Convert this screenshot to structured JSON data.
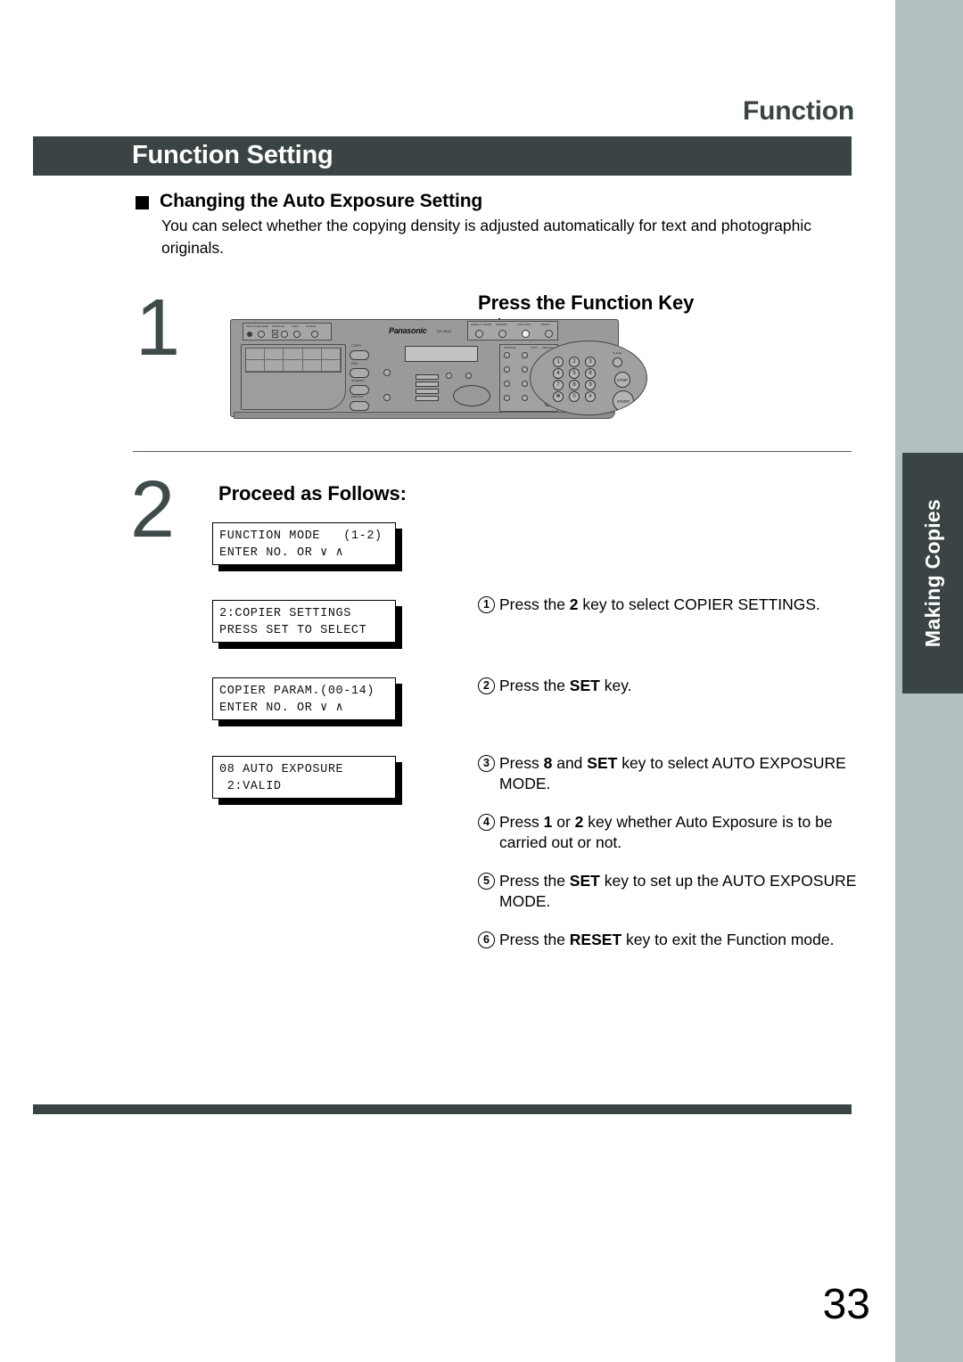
{
  "page": {
    "running_head": "Function",
    "number": "33"
  },
  "section": {
    "title": "Function Setting"
  },
  "subsection": {
    "heading": "Changing the Auto Exposure Setting",
    "intro": "You can select whether the copying density is adjusted automatically for text and photographic originals."
  },
  "side_tab": {
    "label": "Making Copies"
  },
  "steps": [
    {
      "number": "1",
      "heading": "Press the Function Key"
    },
    {
      "number": "2",
      "heading": "Proceed as Follows:"
    }
  ],
  "lcd_displays": [
    {
      "line1": "FUNCTION MODE   (1-2)",
      "line2": "ENTER NO. OR ∨ ∧"
    },
    {
      "line1": "2:COPIER SETTINGS",
      "line2": "PRESS SET TO SELECT"
    },
    {
      "line1": "COPIER PARAM.(00-14)",
      "line2": "ENTER NO. OR ∨ ∧"
    },
    {
      "line1": "08 AUTO EXPOSURE",
      "line2": " 2:VALID"
    }
  ],
  "instructions": [
    {
      "marker": "1",
      "pre": "Press the ",
      "bold": "2",
      "post": " key to select COPIER SETTINGS."
    },
    {
      "marker": "2",
      "pre": "Press the ",
      "bold": "SET",
      "post": " key."
    },
    {
      "marker": "3",
      "pre": "Press ",
      "bold": "8",
      "post": " and ",
      "bold2": "SET",
      "post2": " key to select AUTO EXPOSURE MODE."
    },
    {
      "marker": "4",
      "pre": "Press ",
      "bold": "1",
      "post": " or ",
      "bold2": "2",
      "post2": " key whether Auto Exposure is to be carried out or not."
    },
    {
      "marker": "5",
      "pre": "Press the ",
      "bold": "SET",
      "post": " key to set up the AUTO EXPOSURE MODE."
    },
    {
      "marker": "6",
      "pre": "Press the ",
      "bold": "RESET",
      "post": " key to exit the Function mode."
    }
  ],
  "control_panel": {
    "brand": "Panasonic",
    "model": "DP-2000",
    "top_right_keys": [
      "ENERGY SAVER",
      "MEMORY",
      "FUNCTION",
      "RESET"
    ],
    "mode_keys": [
      "COPY",
      "FAX",
      "INTERNET",
      "PRINTER"
    ],
    "keypad": [
      "1",
      "2",
      "3",
      "4",
      "5",
      "6",
      "7",
      "8",
      "9",
      "✻",
      "0",
      "#"
    ],
    "action_keys": [
      "CLEAR",
      "STOP",
      "START"
    ]
  },
  "colors": {
    "dark": "#3a4445",
    "rail": "#b3c0c0",
    "text": "#000000"
  }
}
